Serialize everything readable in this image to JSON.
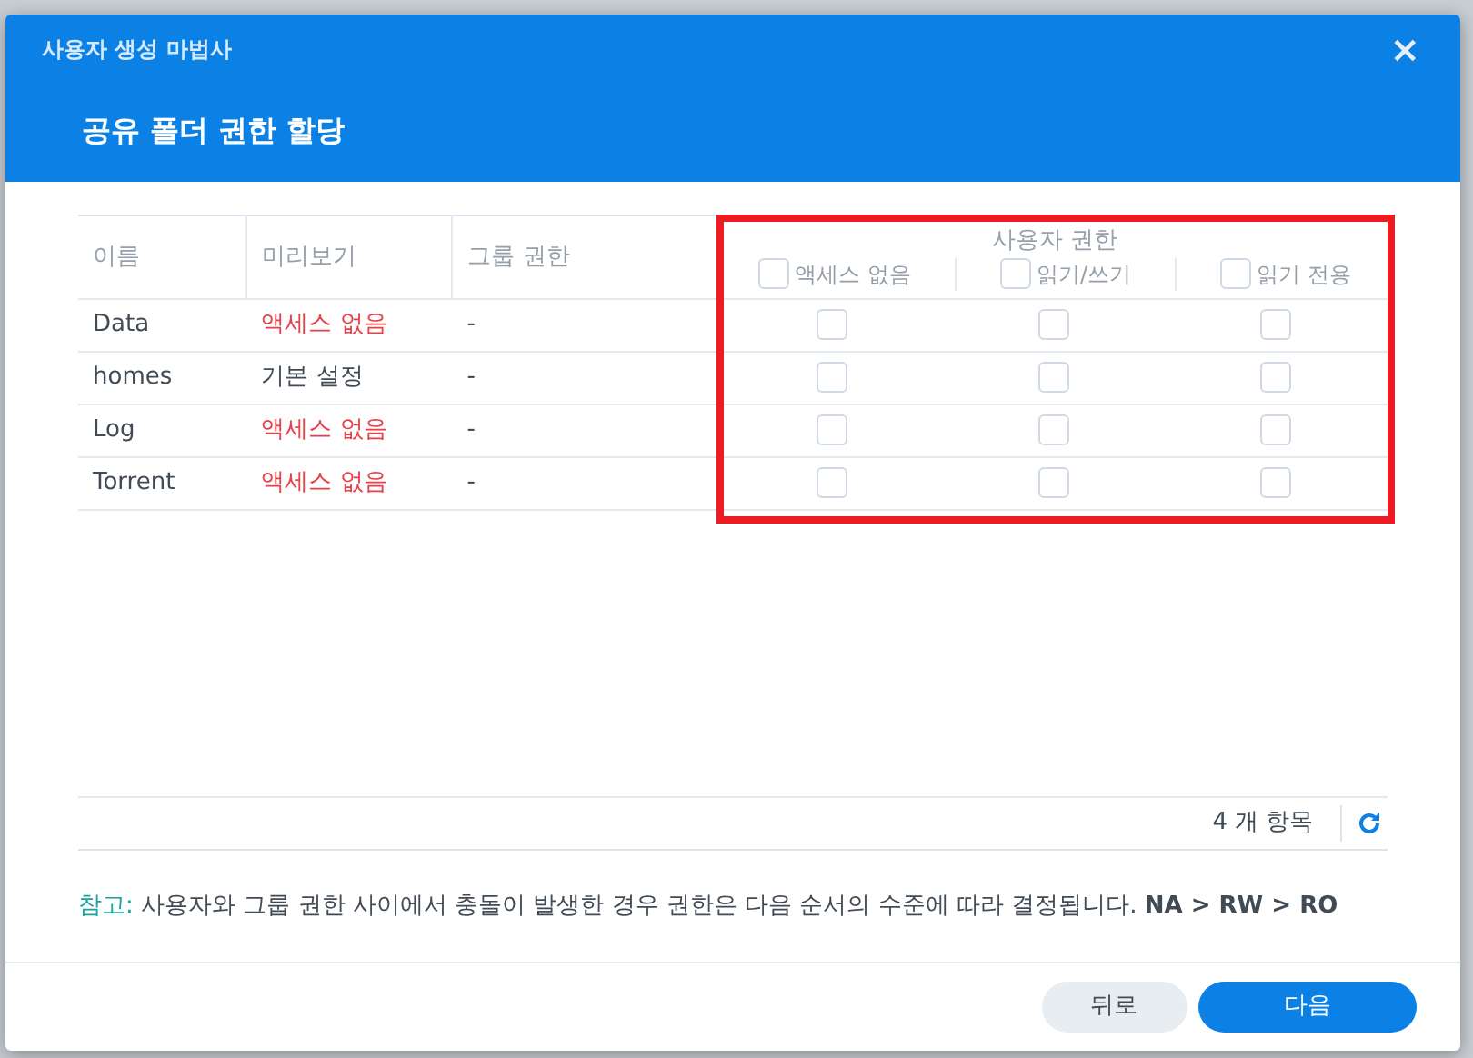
{
  "window": {
    "title": "사용자 생성 마법사",
    "close": "×"
  },
  "step_title": "공유 폴더 권한 할당",
  "table": {
    "columns": [
      "이름",
      "미리보기",
      "그룹 권한"
    ],
    "user_permissions": {
      "title": "사용자 권한",
      "highlighted": true,
      "options": [
        {
          "label": "액세스 없음",
          "checked": false
        },
        {
          "label": "읽기/쓰기",
          "checked": false
        },
        {
          "label": "읽기 전용",
          "checked": false
        }
      ]
    },
    "rows": [
      {
        "name": "Data",
        "preview": "액세스 없음",
        "preview_alert": true,
        "group": "-",
        "perms": [
          false,
          false,
          false
        ]
      },
      {
        "name": "homes",
        "preview": "기본 설정",
        "preview_alert": false,
        "group": "-",
        "perms": [
          false,
          false,
          false
        ]
      },
      {
        "name": "Log",
        "preview": "액세스 없음",
        "preview_alert": true,
        "group": "-",
        "perms": [
          false,
          false,
          false
        ]
      },
      {
        "name": "Torrent",
        "preview": "액세스 없음",
        "preview_alert": true,
        "group": "-",
        "perms": [
          false,
          false,
          false
        ]
      }
    ]
  },
  "item_count": "4 개 항목",
  "note": "참고: 사용자와 그룹 권한 사이에서 충돌이 발생한 경우 권한은 다음 순서의 수준에 따라 결정됩니다. **NA > RW > RO**",
  "buttons": [
    {
      "label": "뒤로",
      "kind": "secondary"
    },
    {
      "label": "다음",
      "kind": "primary"
    }
  ]
}
